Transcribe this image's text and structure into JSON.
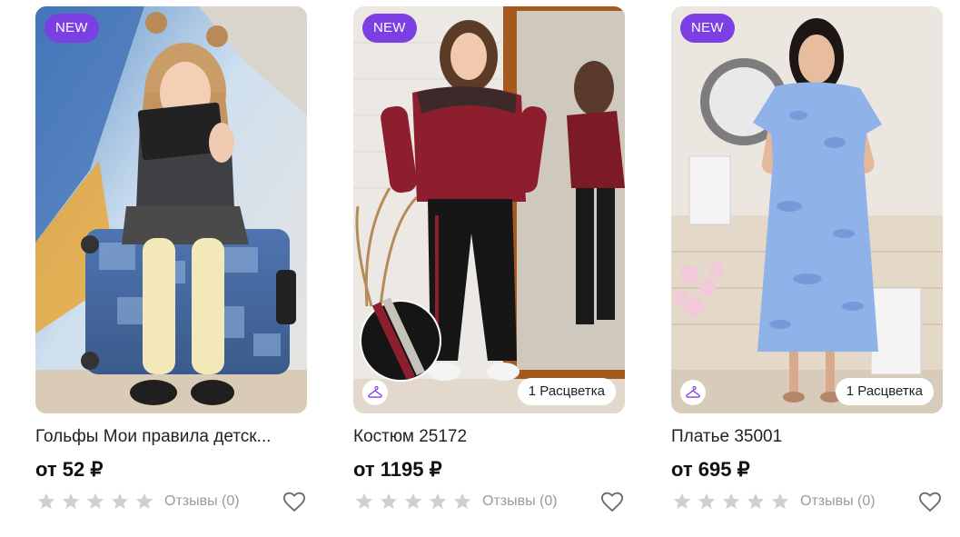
{
  "products": [
    {
      "badge": "NEW",
      "title": "Гольфы Мои правила детск...",
      "price": "от 52 ₽",
      "rating": 0,
      "reviews": "Отзывы (0)",
      "colors": ""
    },
    {
      "badge": "NEW",
      "title": "Костюм 25172",
      "price": "от 1195 ₽",
      "rating": 0,
      "reviews": "Отзывы (0)",
      "colors": "1 Расцветка"
    },
    {
      "badge": "NEW",
      "title": "Платье 35001",
      "price": "от 695 ₽",
      "rating": 0,
      "reviews": "Отзывы (0)",
      "colors": "1 Расцветка"
    }
  ],
  "colors": {
    "badge_bg": "#7b3fe4",
    "star_empty": "#d0d0d0",
    "reviews_text": "#9b9b9b",
    "hanger_icon": "#8a3fe6"
  },
  "icons": {
    "star": "star-icon",
    "favorite": "heart-outline-icon",
    "hanger": "hanger-icon"
  }
}
